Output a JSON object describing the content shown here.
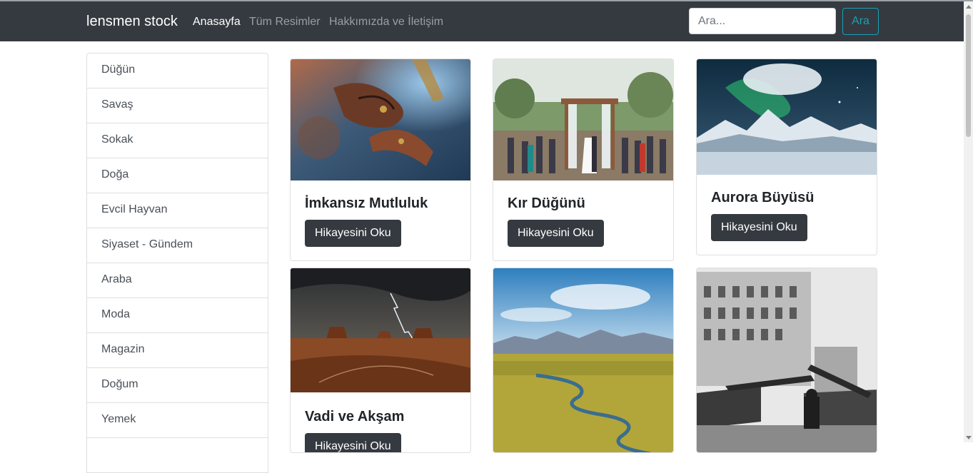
{
  "navbar": {
    "brand": "lensmen stock",
    "links": [
      {
        "label": "Anasayfa",
        "active": true
      },
      {
        "label": "Tüm Resimler",
        "active": false
      },
      {
        "label": "Hakkımızda ve İletişim",
        "active": false
      }
    ],
    "search": {
      "placeholder": "Ara...",
      "value": "",
      "button_label": "Ara"
    }
  },
  "sidebar": {
    "categories": [
      "Düğün",
      "Savaş",
      "Sokak",
      "Doğa",
      "Evcil Hayvan",
      "Siyaset - Gündem",
      "Araba",
      "Moda",
      "Magazin",
      "Doğum",
      "Yemek",
      ""
    ]
  },
  "cards": [
    {
      "title": "İmkansız Mutluluk",
      "button_label": "Hikayesini Oku",
      "image": "henna-hands-photo"
    },
    {
      "title": "Kır Düğünü",
      "button_label": "Hikayesini Oku",
      "image": "outdoor-wedding-photo"
    },
    {
      "title": "Aurora Büyüsü",
      "button_label": "Hikayesini Oku",
      "image": "aurora-mountains-photo"
    },
    {
      "title": "Vadi ve Akşam",
      "button_label": "Hikayesini Oku",
      "image": "desert-lightning-photo"
    },
    {
      "title": "",
      "button_label": "",
      "image": "river-valley-photo"
    },
    {
      "title": "",
      "button_label": "",
      "image": "tank-parade-photo"
    }
  ],
  "colors": {
    "navbar": "#343a40",
    "accent": "#17a2b8",
    "button": "#343a40"
  }
}
